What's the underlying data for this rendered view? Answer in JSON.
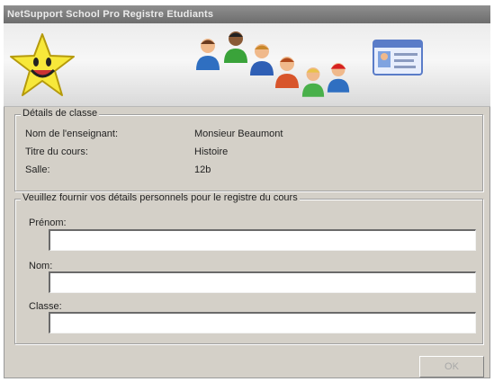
{
  "window": {
    "title": "NetSupport School Pro Registre Etudiants"
  },
  "class_details": {
    "legend": "Détails de classe",
    "teacher_label": "Nom de l'enseignant:",
    "teacher_value": "Monsieur Beaumont",
    "course_label": "Titre du cours:",
    "course_value": "Histoire",
    "room_label": "Salle:",
    "room_value": "12b"
  },
  "personal_details": {
    "legend": "Veuillez fournir vos détails personnels pour le registre du cours",
    "firstname_label": "Prénom:",
    "firstname_value": "",
    "lastname_label": "Nom:",
    "lastname_value": "",
    "class_label": "Classe:",
    "class_value": ""
  },
  "footer": {
    "ok_label": "OK"
  },
  "icons": [
    "star-mascot-icon",
    "student-icon",
    "id-card-icon"
  ],
  "colors": {
    "title_bar": "#7a7a7a",
    "dialog_bg": "#d4d0c8",
    "star": "#f7e83a"
  }
}
